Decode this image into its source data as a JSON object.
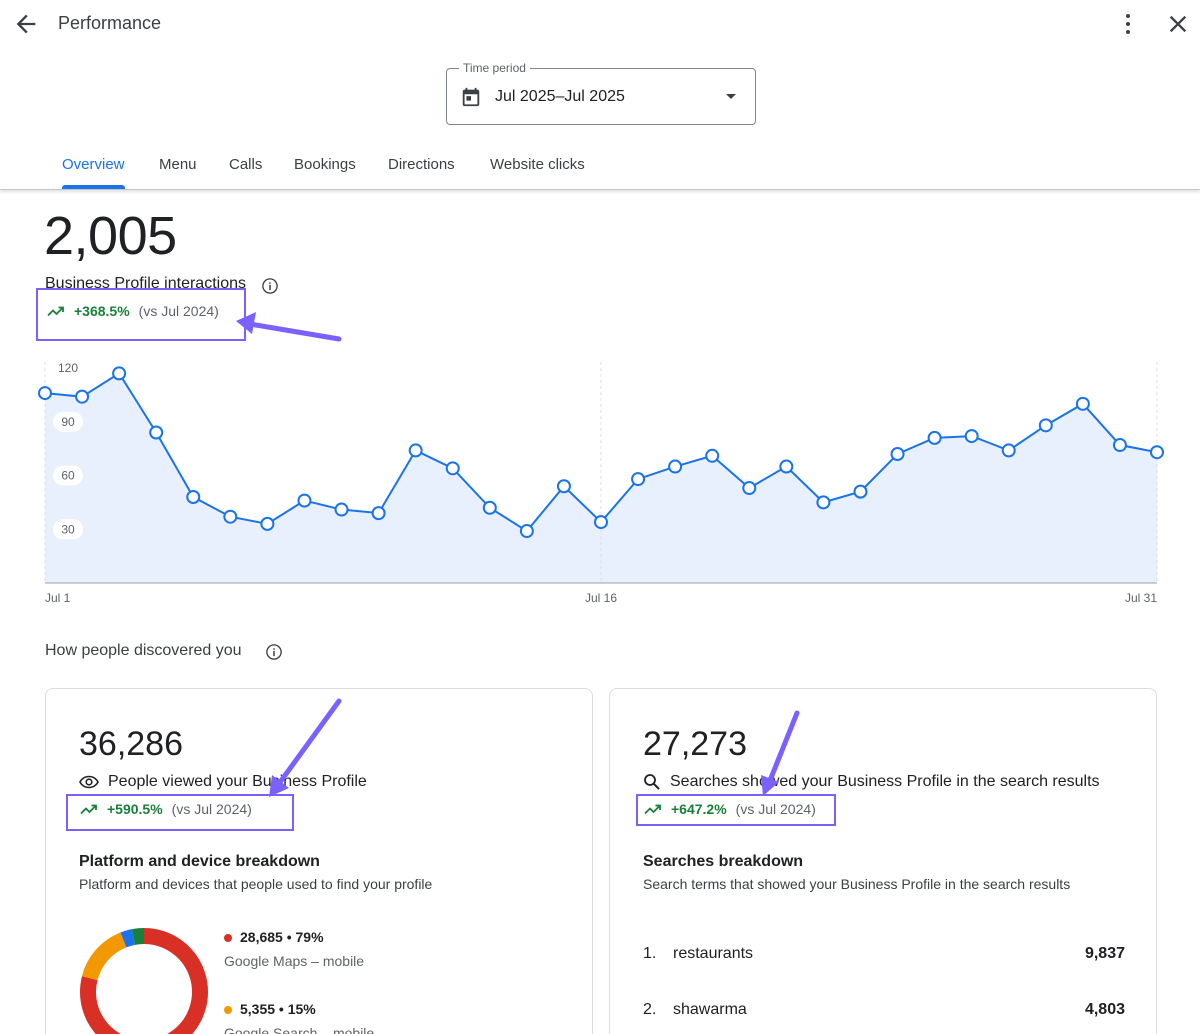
{
  "header": {
    "title": "Performance",
    "back_icon": "arrow-back-icon",
    "more_icon": "more-vert-icon",
    "close_icon": "close-icon"
  },
  "time_period": {
    "label": "Time period",
    "value": "Jul 2025–Jul 2025",
    "icon": "calendar-icon"
  },
  "tabs": [
    {
      "label": "Overview",
      "active": true
    },
    {
      "label": "Menu",
      "active": false
    },
    {
      "label": "Calls",
      "active": false
    },
    {
      "label": "Bookings",
      "active": false
    },
    {
      "label": "Directions",
      "active": false
    },
    {
      "label": "Website clicks",
      "active": false
    }
  ],
  "interactions": {
    "total": "2,005",
    "label": "Business Profile interactions",
    "trend_pct": "+368.5%",
    "trend_vs": "(vs Jul 2024)"
  },
  "chart_data": {
    "type": "area",
    "x": [
      "Jul 1",
      "Jul 2",
      "Jul 3",
      "Jul 4",
      "Jul 5",
      "Jul 6",
      "Jul 7",
      "Jul 8",
      "Jul 9",
      "Jul 10",
      "Jul 11",
      "Jul 12",
      "Jul 13",
      "Jul 14",
      "Jul 15",
      "Jul 16",
      "Jul 17",
      "Jul 18",
      "Jul 19",
      "Jul 20",
      "Jul 21",
      "Jul 22",
      "Jul 23",
      "Jul 24",
      "Jul 25",
      "Jul 26",
      "Jul 27",
      "Jul 28",
      "Jul 29",
      "Jul 30",
      "Jul 31"
    ],
    "values": [
      106,
      104,
      117,
      84,
      48,
      37,
      33,
      46,
      41,
      39,
      74,
      64,
      42,
      29,
      54,
      34,
      58,
      65,
      71,
      53,
      65,
      45,
      51,
      72,
      81,
      82,
      74,
      88,
      100,
      77,
      73
    ],
    "yticks": [
      30,
      60,
      90,
      120
    ],
    "xticks": [
      "Jul 1",
      "Jul 16",
      "Jul 31"
    ],
    "ylim": [
      0,
      120
    ],
    "color": "#1a73e8",
    "fill": "#e8f0fe"
  },
  "discovery": {
    "title": "How people discovered you"
  },
  "views_card": {
    "total": "36,286",
    "label": "People viewed your Business Profile",
    "trend_pct": "+590.5%",
    "trend_vs": "(vs Jul 2024)",
    "breakdown_title": "Platform and device breakdown",
    "breakdown_sub": "Platform and devices that people used to find your profile",
    "legend": [
      {
        "value": "28,685 • 79%",
        "label": "Google Maps – mobile",
        "color": "#d93025"
      },
      {
        "value": "5,355 • 15%",
        "label": "Google Search – mobile",
        "color": "#f29900"
      }
    ],
    "donut": [
      {
        "value": 79,
        "color": "#d93025"
      },
      {
        "value": 15,
        "color": "#f29900"
      },
      {
        "value": 3,
        "color": "#1a73e8"
      },
      {
        "value": 3,
        "color": "#188038"
      }
    ]
  },
  "search_card": {
    "total": "27,273",
    "label": "Searches showed your Business Profile in the search results",
    "trend_pct": "+647.2%",
    "trend_vs": "(vs Jul 2024)",
    "breakdown_title": "Searches breakdown",
    "breakdown_sub": "Search terms that showed your Business Profile in the search results",
    "rows": [
      {
        "rank": "1.",
        "term": "restaurants",
        "count": "9,837"
      },
      {
        "rank": "2.",
        "term": "shawarma",
        "count": "4,803"
      }
    ]
  }
}
